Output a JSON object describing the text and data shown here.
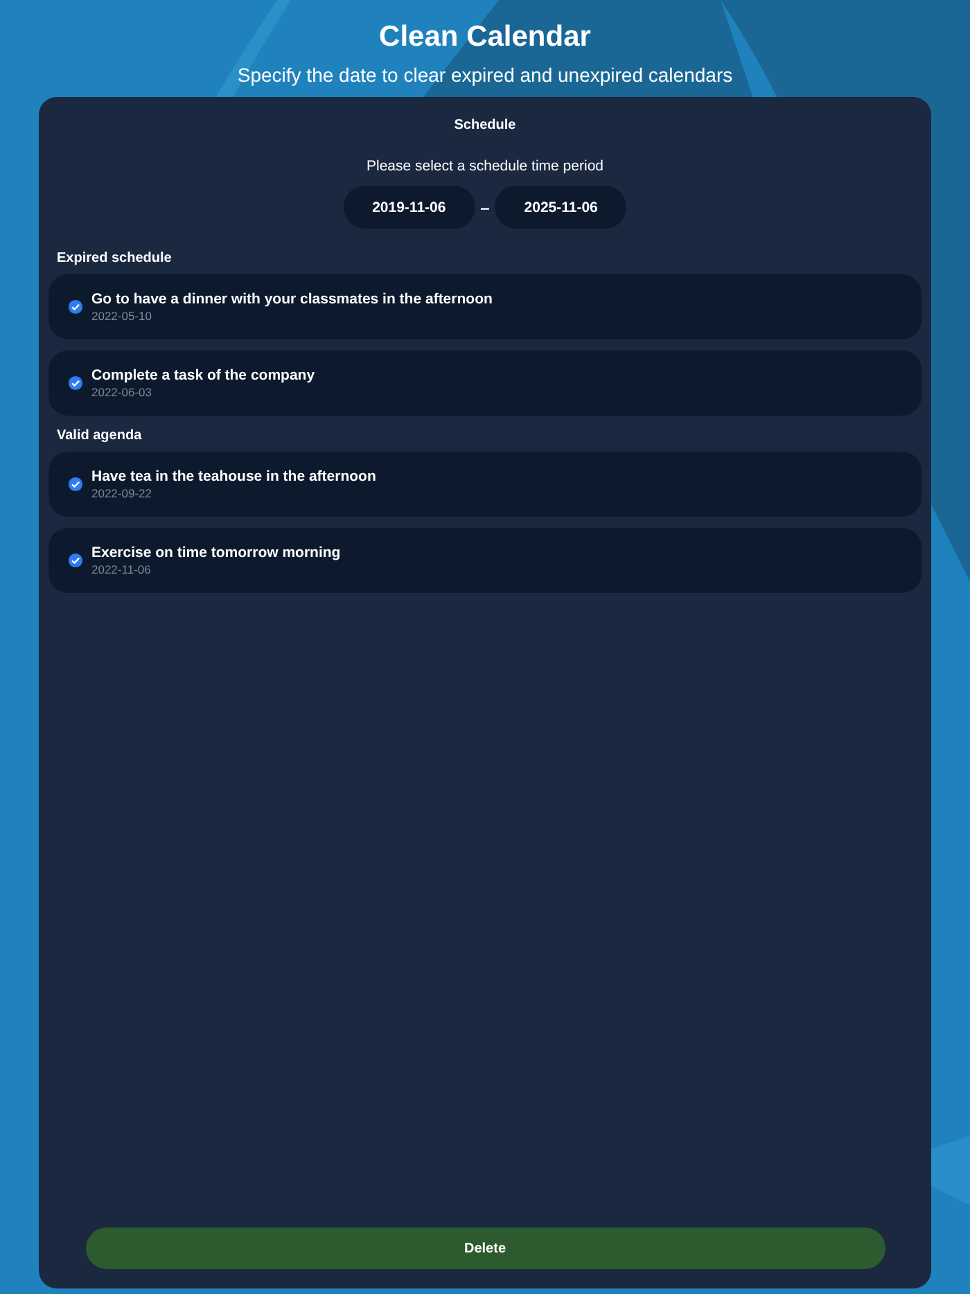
{
  "header": {
    "title": "Clean Calendar",
    "subtitle": "Specify the date to clear expired and unexpired calendars"
  },
  "panel": {
    "title": "Schedule",
    "period_prompt": "Please select a schedule time period",
    "start_date": "2019-11-06",
    "separator": "–",
    "end_date": "2025-11-06",
    "sections": [
      {
        "heading": "Expired schedule",
        "items": [
          {
            "title": "Go to have a dinner with your classmates in the afternoon",
            "date": "2022-05-10",
            "checked": true
          },
          {
            "title": "Complete a task of the company",
            "date": "2022-06-03",
            "checked": true
          }
        ]
      },
      {
        "heading": "Valid agenda",
        "items": [
          {
            "title": "Have tea in the teahouse in the afternoon",
            "date": "2022-09-22",
            "checked": true
          },
          {
            "title": "Exercise on time tomorrow morning",
            "date": "2022-11-06",
            "checked": true
          }
        ]
      }
    ],
    "delete_button": "Delete"
  }
}
